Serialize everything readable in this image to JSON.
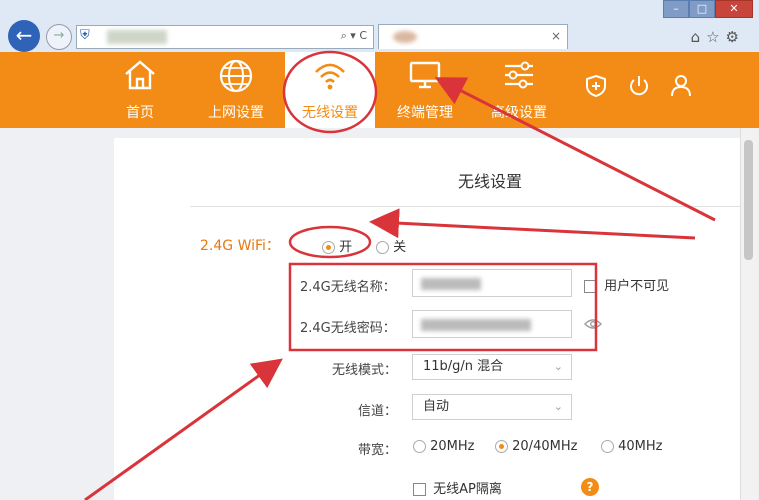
{
  "browser": {
    "back_icon": "arrow-left-icon",
    "forward_icon": "arrow-right-icon",
    "address_controls": "⌕ ▾ C",
    "tab_close": "×",
    "right_icons": "⌂☆⚙",
    "window_buttons": [
      "–",
      "□",
      "✕"
    ]
  },
  "nav": {
    "items": [
      {
        "label": "首页",
        "icon": "home-icon"
      },
      {
        "label": "上网设置",
        "icon": "globe-icon"
      },
      {
        "label": "无线设置",
        "icon": "wifi-icon",
        "active": true
      },
      {
        "label": "终端管理",
        "icon": "monitor-icon"
      },
      {
        "label": "高级设置",
        "icon": "sliders-icon"
      }
    ],
    "right_icons": [
      "shield-plus-icon",
      "power-icon",
      "user-icon"
    ]
  },
  "page": {
    "title": "无线设置",
    "wifi_label": "2.4G WiFi：",
    "wifi_on": "开",
    "wifi_off": "关",
    "ssid_label": "2.4G无线名称：",
    "password_label": "2.4G无线密码：",
    "hide_ssid_label": "用户不可见",
    "mode_label": "无线模式：",
    "mode_value": "11b/g/n 混合",
    "channel_label": "信道：",
    "channel_value": "自动",
    "bandwidth_label": "带宽：",
    "bw_options": [
      "20MHz",
      "20/40MHz",
      "40MHz"
    ],
    "bw_selected": "20/40MHz",
    "ap_isolation_label": "无线AP隔离",
    "help_mark": "?"
  },
  "colors": {
    "accent": "#f28c16",
    "annotation": "#d9343a"
  }
}
